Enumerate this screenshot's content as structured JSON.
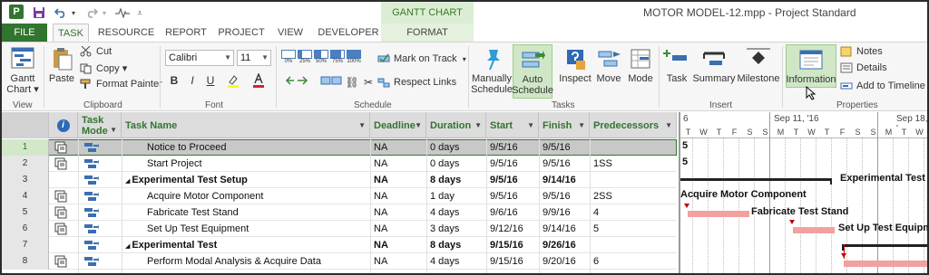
{
  "window": {
    "app_logo": "P",
    "title": "MOTOR MODEL-12.mpp - Project Standard",
    "context_tab_group": "GANTT CHART TOOLS"
  },
  "quick_access": {
    "save_icon": "save-icon",
    "undo_icon": "undo-icon",
    "redo_icon": "redo-icon",
    "customize_icon": "customize-icon"
  },
  "tabs": {
    "file": "FILE",
    "task": "TASK",
    "resource": "RESOURCE",
    "report": "REPORT",
    "project": "PROJECT",
    "view": "VIEW",
    "developer": "DEVELOPER",
    "format": "FORMAT"
  },
  "ribbon": {
    "view": {
      "gantt_chart_line1": "Gantt",
      "gantt_chart_line2": "Chart ▾",
      "label": "View"
    },
    "clipboard": {
      "paste": "Paste",
      "cut": "Cut",
      "copy": "Copy ▾",
      "format_painter": "Format Painter",
      "label": "Clipboard"
    },
    "font": {
      "font_name": "Calibri",
      "font_size": "11",
      "bold": "B",
      "italic": "I",
      "underline": "U",
      "label": "Font"
    },
    "schedule": {
      "percents": [
        "0%",
        "25%",
        "50%",
        "75%",
        "100%"
      ],
      "mark_on_track": "Mark on Track",
      "respect_links": "Respect Links",
      "label": "Schedule"
    },
    "tasks": {
      "manually_line1": "Manually",
      "manually_line2": "Schedule",
      "auto_line1": "Auto",
      "auto_line2": "Schedule",
      "inspect": "Inspect",
      "move": "Move",
      "mode": "Mode",
      "label": "Tasks"
    },
    "insert": {
      "task": "Task",
      "summary": "Summary",
      "milestone": "Milestone",
      "label": "Insert"
    },
    "properties": {
      "information": "Information",
      "notes": "Notes",
      "details": "Details",
      "add_to_timeline": "Add to Timeline",
      "label": "Properties"
    }
  },
  "grid": {
    "columns": {
      "info": "i",
      "task_mode_line1": "Task",
      "task_mode_line2": "Mode",
      "task_name": "Task Name",
      "deadline": "Deadline",
      "duration": "Duration",
      "start": "Start",
      "finish": "Finish",
      "predecessors": "Predecessors"
    },
    "rows": [
      {
        "id": "1",
        "name": "Notice to Proceed",
        "deadline": "NA",
        "duration": "0 days",
        "start": "9/5/16",
        "finish": "9/5/16",
        "pred": "",
        "summary": false,
        "indent": 1,
        "selected": true,
        "has_info": true
      },
      {
        "id": "2",
        "name": "Start Project",
        "deadline": "NA",
        "duration": "0 days",
        "start": "9/5/16",
        "finish": "9/5/16",
        "pred": "1SS",
        "summary": false,
        "indent": 1,
        "selected": false,
        "has_info": true
      },
      {
        "id": "3",
        "name": "Experimental Test Setup",
        "deadline": "NA",
        "duration": "8 days",
        "start": "9/5/16",
        "finish": "9/14/16",
        "pred": "",
        "summary": true,
        "indent": 0,
        "selected": false,
        "has_info": false
      },
      {
        "id": "4",
        "name": "Acquire Motor Component",
        "deadline": "NA",
        "duration": "1 day",
        "start": "9/5/16",
        "finish": "9/5/16",
        "pred": "2SS",
        "summary": false,
        "indent": 1,
        "selected": false,
        "has_info": true
      },
      {
        "id": "5",
        "name": "Fabricate Test Stand",
        "deadline": "NA",
        "duration": "4 days",
        "start": "9/6/16",
        "finish": "9/9/16",
        "pred": "4",
        "summary": false,
        "indent": 1,
        "selected": false,
        "has_info": true
      },
      {
        "id": "6",
        "name": "Set Up Test Equipment",
        "deadline": "NA",
        "duration": "3 days",
        "start": "9/12/16",
        "finish": "9/14/16",
        "pred": "5",
        "summary": false,
        "indent": 1,
        "selected": false,
        "has_info": true
      },
      {
        "id": "7",
        "name": "Experimental Test",
        "deadline": "NA",
        "duration": "8 days",
        "start": "9/15/16",
        "finish": "9/26/16",
        "pred": "",
        "summary": true,
        "indent": 0,
        "selected": false,
        "has_info": false
      },
      {
        "id": "8",
        "name": "Perform Modal Analysis & Acquire Data",
        "deadline": "NA",
        "duration": "4 days",
        "start": "9/15/16",
        "finish": "9/20/16",
        "pred": "6",
        "summary": false,
        "indent": 1,
        "selected": false,
        "has_info": true
      }
    ]
  },
  "gantt": {
    "week_labels": [
      "6",
      "Sep 11, '16",
      "Sep 18, '"
    ],
    "days": [
      "T",
      "W",
      "T",
      "F",
      "S",
      "S",
      "M",
      "T",
      "W",
      "T",
      "F",
      "S",
      "S",
      "M",
      "T",
      "W"
    ],
    "milestone_labels": [
      "5",
      "5"
    ],
    "bar_labels": {
      "experimental_test_setup": "Experimental Test S",
      "acquire_motor_component": "Acquire Motor Component",
      "fabricate_test_stand": "Fabricate Test Stand",
      "set_up_test_equipment": "Set Up Test Equipm"
    },
    "colors": {
      "task_bar": "#f2a0a0",
      "summary_bar": "#222222",
      "link_arrow": "#c00000"
    }
  }
}
